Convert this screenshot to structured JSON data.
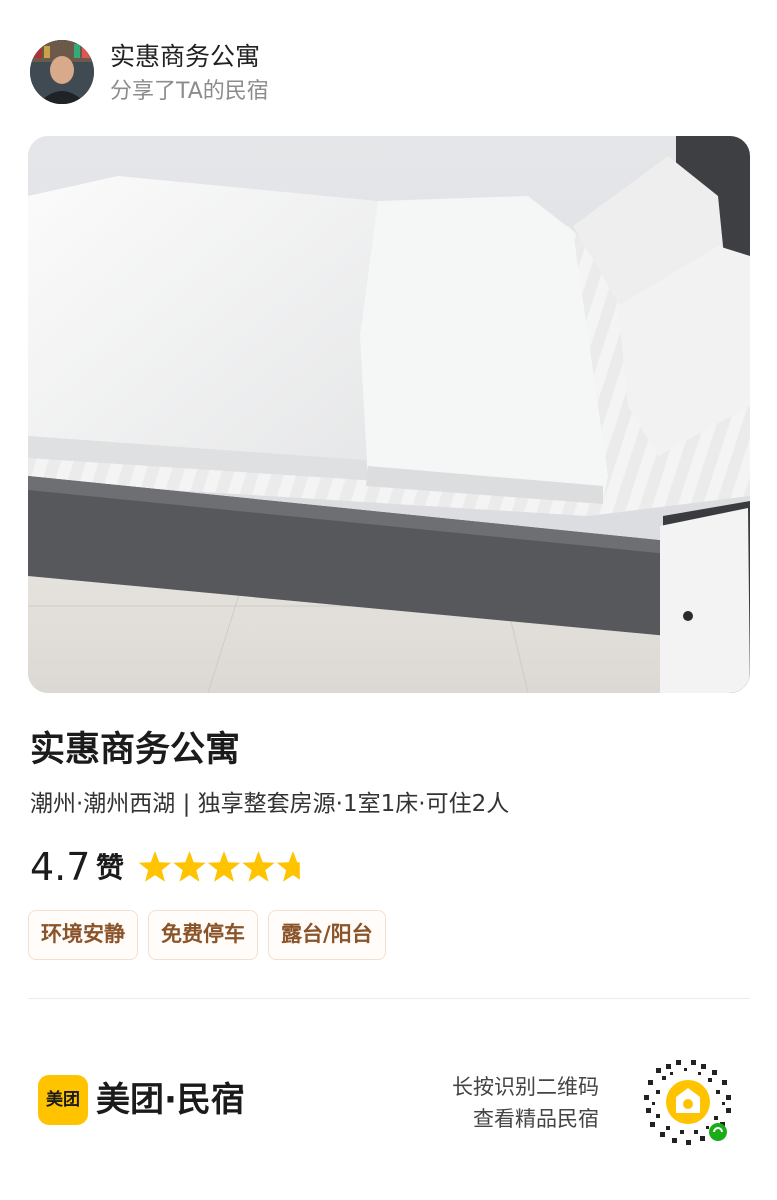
{
  "share": {
    "avatar_icon": "user-avatar",
    "title": "实惠商务公寓",
    "subtitle": "分享了TA的民宿"
  },
  "listing": {
    "photo_icon": "bedroom-photo",
    "name": "实惠商务公寓",
    "info": "潮州·潮州西湖 | 独享整套房源·1室1床·可住2人",
    "rating": {
      "score": "4.7",
      "praise": "赞",
      "stars_value": 4.7,
      "stars_max": 5,
      "star_color": "#FFC300"
    },
    "tags": [
      "环境安静",
      "免费停车",
      "露台/阳台"
    ]
  },
  "footer": {
    "brand_logo_text": "美团",
    "brand_name": "美团·民宿",
    "brand_color": "#FFC300",
    "qr_hint_line1": "长按识别二维码",
    "qr_hint_line2": "查看精品民宿",
    "qr_icon": "mini-program-qr-code"
  }
}
